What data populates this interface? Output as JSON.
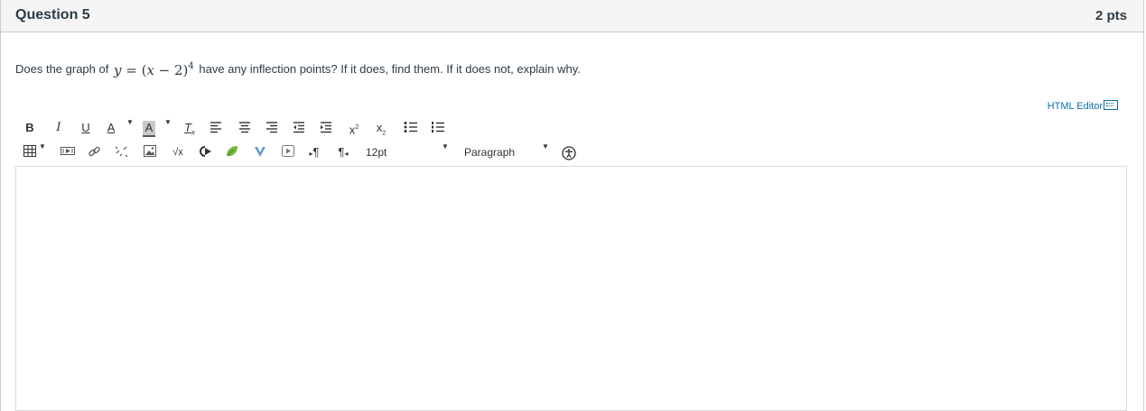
{
  "question": {
    "title": "Question 5",
    "points": "2 pts",
    "text_before": "Does the graph of",
    "math": {
      "y": "y",
      "eq": " = (",
      "x": "x",
      "rest": " − 2)",
      "exp": "4"
    },
    "text_after": " have any inflection points? If it does, find them. If it does not, explain why."
  },
  "editor": {
    "html_editor_label": "HTML Editor",
    "font_size": "12pt",
    "block_format": "Paragraph",
    "content": ""
  },
  "toolbar": {
    "bold": "B",
    "italic": "I",
    "underline": "U",
    "text_color": "A",
    "background_color": "A",
    "clear_format": "T",
    "superscript": "x",
    "subscript": "x",
    "ltr": "¶",
    "rtl": "¶",
    "sqrt": "√x"
  },
  "colors": {
    "accent": "#0a6ea8",
    "header_bg": "#f5f5f5",
    "text": "#2d3b45",
    "border": "#c7cdd1",
    "leaf": "#76b73c",
    "media_v": "#5b9bd5"
  }
}
